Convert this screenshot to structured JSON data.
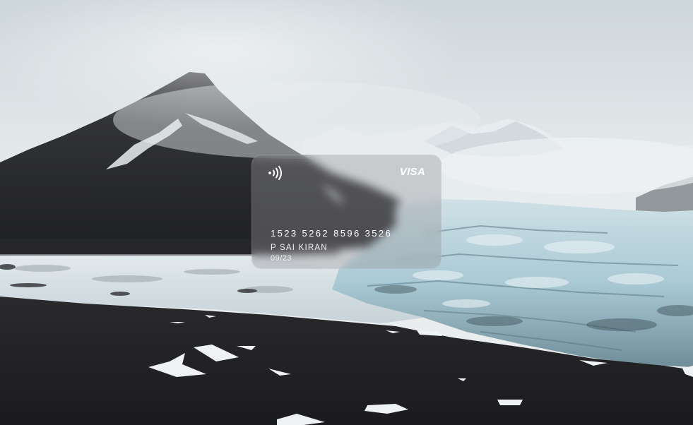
{
  "background": {
    "description_icon": "glacier-landscape-photo"
  },
  "card": {
    "brand": "VISA",
    "number": "1523 5262 8596 3526",
    "holder": "P SAI KIRAN",
    "expiry": "09/23",
    "contactless_icon": "contactless-icon"
  },
  "colors": {
    "sky": "#dfe5e7",
    "ice": "#b9d3dc",
    "ground": "#222224",
    "card_glass": "#96969b"
  }
}
